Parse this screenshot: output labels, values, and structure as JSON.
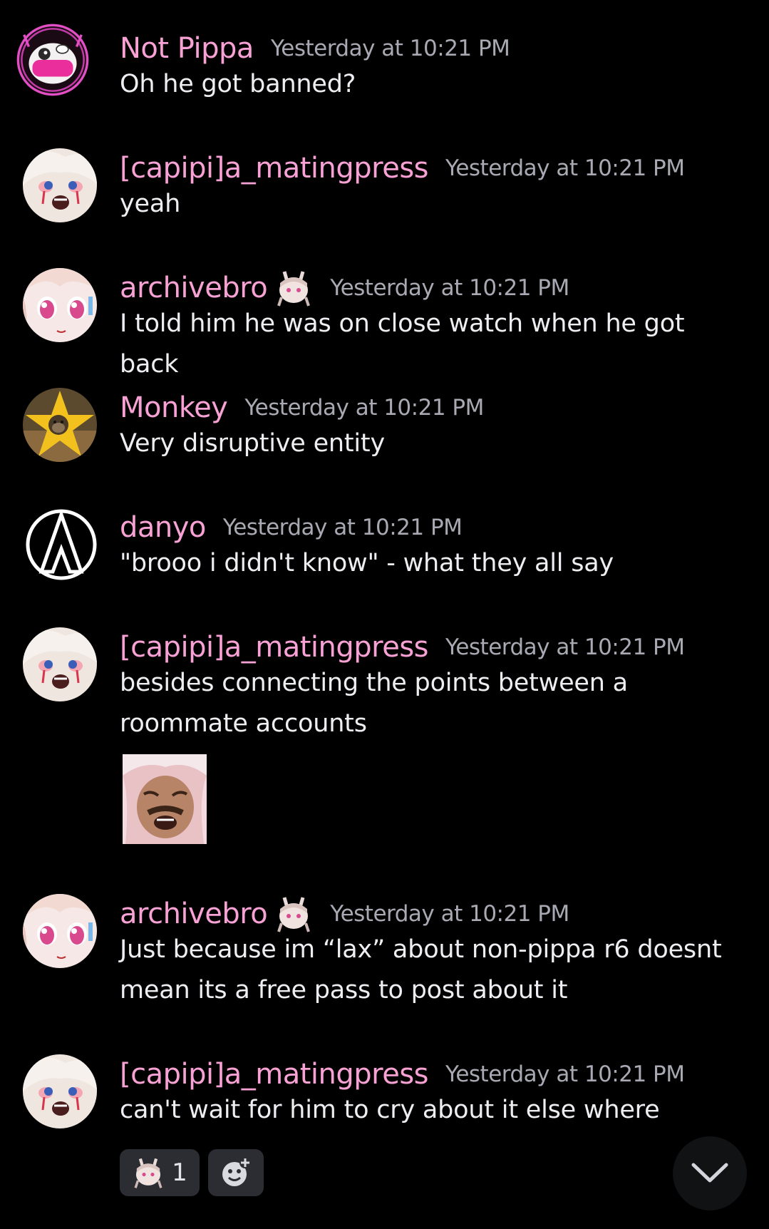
{
  "colors": {
    "background": "#000000",
    "username": "#f7a1d4",
    "timestamp": "#a8a9b3",
    "message_text": "#eeeef2",
    "reaction_bg": "#2c2d33"
  },
  "messages": [
    {
      "author": "Not Pippa",
      "timestamp": "Yesterday at 10:21 PM",
      "text": "Oh he got banned?",
      "avatar": "pink-robot-avatar"
    },
    {
      "author": "[capipi]a_matingpress",
      "timestamp": "Yesterday at 10:21 PM",
      "text": "yeah",
      "avatar": "anime-girl-crying-avatar"
    },
    {
      "author": "archivebro",
      "timestamp": "Yesterday at 10:21 PM",
      "text": "I told him he was on close watch when he got back",
      "avatar": "anime-girl-pink-eyes-avatar",
      "badge": "bunny-girl-badge-icon"
    },
    {
      "author": "Monkey",
      "timestamp": "Yesterday at 10:21 PM",
      "text": "Very disruptive entity",
      "avatar": "monkey-star-avatar"
    },
    {
      "author": "danyo",
      "timestamp": "Yesterday at 10:21 PM",
      "text": "\"brooo i didn't know\" - what they all say",
      "avatar": "triangle-logo-avatar"
    },
    {
      "author": "[capipi]a_matingpress",
      "timestamp": "Yesterday at 10:21 PM",
      "text": "besides connecting the points between a roommate accounts",
      "avatar": "anime-girl-crying-avatar",
      "attachment": "laughing-man-image"
    },
    {
      "author": "archivebro",
      "timestamp": "Yesterday at 10:21 PM",
      "text": "Just because im “lax” about non-pippa r6 doesnt mean its a free pass to post about it",
      "avatar": "anime-girl-pink-eyes-avatar",
      "badge": "bunny-girl-badge-icon"
    },
    {
      "author": "[capipi]a_matingpress",
      "timestamp": "Yesterday at 10:21 PM",
      "text": "can't wait for him to cry about it else where",
      "avatar": "anime-girl-crying-avatar",
      "reactions": [
        {
          "emoji": "bunny-girl-emoji-icon",
          "count": "1"
        }
      ],
      "add_reaction": "add-reaction-icon"
    }
  ],
  "scroll_button": "chevron-down-icon"
}
